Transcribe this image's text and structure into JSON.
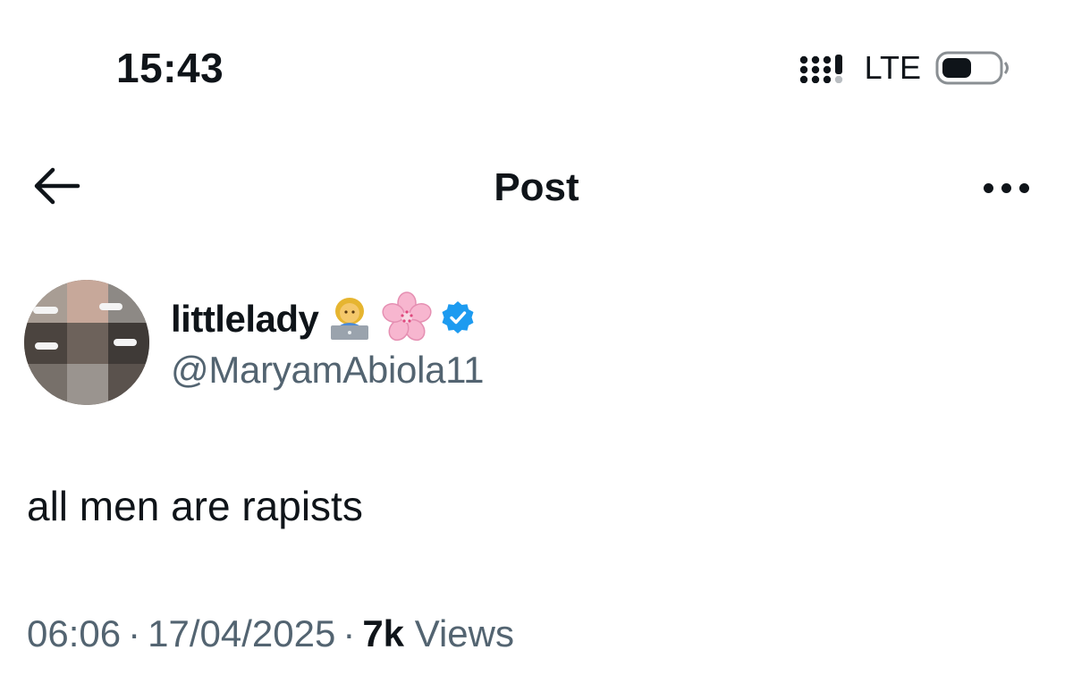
{
  "status_bar": {
    "time": "15:43",
    "network": "LTE",
    "icons": [
      "signal-icon",
      "battery-icon"
    ]
  },
  "nav": {
    "title": "Post",
    "icons": [
      "back-arrow-icon",
      "more-options-icon"
    ]
  },
  "author": {
    "display_name": "littlelady",
    "handle": "@MaryamAbiola11",
    "name_emojis": [
      "woman-technologist-emoji",
      "cherry-blossom-emoji"
    ],
    "verified": true,
    "verified_color": "#1d9bf0"
  },
  "post": {
    "text": "all men are rapists"
  },
  "meta": {
    "time": "06:06",
    "separator": "·",
    "date": "17/04/2025",
    "views_count": "7k",
    "views_label": "Views"
  },
  "colors": {
    "text_primary": "#0f1419",
    "text_secondary": "#536471",
    "background": "#ffffff"
  }
}
